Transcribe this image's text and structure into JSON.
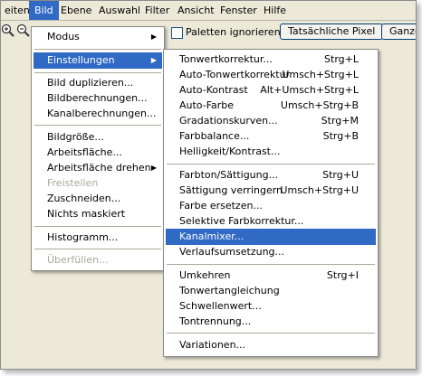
{
  "menubar": {
    "items": [
      "eiten",
      "Bild",
      "Ebene",
      "Auswahl",
      "Filter",
      "Ansicht",
      "Fenster",
      "Hilfe"
    ]
  },
  "toolbar": {
    "palettes_checkbox_label": "Paletten ignorieren",
    "actual_pixels_button": "Tatsächliche Pixel",
    "whole_button": "Ganzes"
  },
  "bild_menu": [
    {
      "label": "Modus",
      "submenu": true
    },
    {
      "label": "Einstellungen",
      "submenu": true,
      "highlighted": true
    },
    {
      "label": "Bild duplizieren..."
    },
    {
      "label": "Bildberechnungen..."
    },
    {
      "label": "Kanalberechnungen..."
    },
    {
      "label": "Bildgröße..."
    },
    {
      "label": "Arbeitsfläche..."
    },
    {
      "label": "Arbeitsfläche drehen",
      "submenu": true
    },
    {
      "label": "Freistellen",
      "disabled": true
    },
    {
      "label": "Zuschneiden..."
    },
    {
      "label": "Nichts maskiert"
    },
    {
      "label": "Histogramm..."
    },
    {
      "label": "Überfüllen...",
      "disabled": true
    }
  ],
  "einstellungen_menu": [
    {
      "label": "Tonwertkorrektur...",
      "shortcut": "Strg+L"
    },
    {
      "label": "Auto-Tonwertkorrektur",
      "shortcut": "Umsch+Strg+L"
    },
    {
      "label": "Auto-Kontrast",
      "shortcut": "Alt+Umsch+Strg+L"
    },
    {
      "label": "Auto-Farbe",
      "shortcut": "Umsch+Strg+B"
    },
    {
      "label": "Gradationskurven...",
      "shortcut": "Strg+M"
    },
    {
      "label": "Farbbalance...",
      "shortcut": "Strg+B"
    },
    {
      "label": "Helligkeit/Kontrast..."
    },
    {
      "label": "Farbton/Sättigung...",
      "shortcut": "Strg+U"
    },
    {
      "label": "Sättigung verringern",
      "shortcut": "Umsch+Strg+U"
    },
    {
      "label": "Farbe ersetzen..."
    },
    {
      "label": "Selektive Farbkorrektur..."
    },
    {
      "label": "Kanalmixer...",
      "highlighted": true
    },
    {
      "label": "Verlaufsumsetzung..."
    },
    {
      "label": "Umkehren",
      "shortcut": "Strg+I"
    },
    {
      "label": "Tonwertangleichung"
    },
    {
      "label": "Schwellenwert..."
    },
    {
      "label": "Tontrennung..."
    },
    {
      "label": "Variationen..."
    }
  ],
  "colors": {
    "highlight": "#316ac5",
    "menubar_bg": "#ece9d8",
    "disabled_text": "#aca899"
  }
}
